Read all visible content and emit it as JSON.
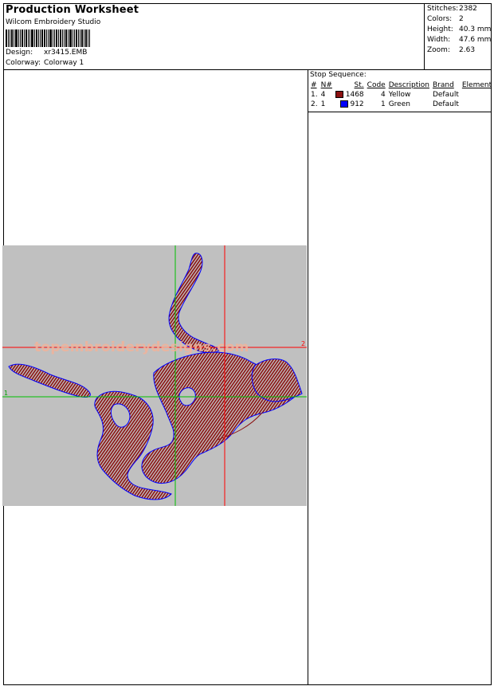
{
  "header": {
    "title": "Production Worksheet",
    "software": "Wilcom Embroidery Studio",
    "design_label": "Design:",
    "design_value": "xr3415.EMB",
    "colorway_label": "Colorway:",
    "colorway_value": "Colorway 1"
  },
  "stats": [
    {
      "label": "Stitches:",
      "value": "2382"
    },
    {
      "label": "Colors:",
      "value": "2"
    },
    {
      "label": "Height:",
      "value": "40.3 mm"
    },
    {
      "label": "Width:",
      "value": "47.6 mm"
    },
    {
      "label": "Zoom:",
      "value": "2.63"
    }
  ],
  "stop_sequence": {
    "title": "Stop Sequence:",
    "columns": [
      "#",
      "N#",
      "St.",
      "Code",
      "Description",
      "Brand",
      "Element"
    ],
    "rows": [
      {
        "index": "1.",
        "n": "4",
        "color": "#8b1010",
        "stitches": "1468",
        "code": "4",
        "description": "Yellow",
        "brand": "Default",
        "element": ""
      },
      {
        "index": "2.",
        "n": "1",
        "color": "#0000ff",
        "stitches": "912",
        "code": "1",
        "description": "Green",
        "brand": "Default",
        "element": ""
      }
    ]
  },
  "design_preview": {
    "background": "#c0c0c0",
    "watermark": "topembroiderydesigns.com",
    "guide_labels": {
      "horizontal_red": "2",
      "horizontal_green": "1"
    },
    "colors": {
      "fill": "#8b1010",
      "outline": "#0000ff",
      "red_guide": "#ff0000",
      "green_guide": "#00c000"
    }
  }
}
